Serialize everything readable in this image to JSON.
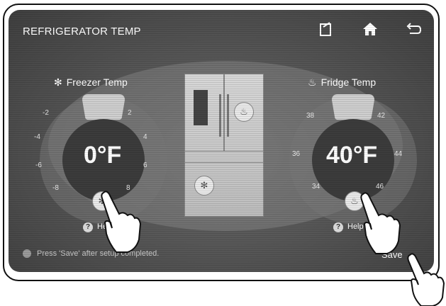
{
  "header": {
    "title": "REFRIGERATOR TEMP",
    "icons": [
      "memo-icon",
      "home-icon",
      "back-icon"
    ]
  },
  "freezer": {
    "label": "Freezer Temp",
    "value": "0°F",
    "ticks": [
      "-2",
      "2",
      "-4",
      "4",
      "-6",
      "6",
      "-8",
      "8"
    ],
    "button_icon": "snowflake-icon",
    "help_label": "Help"
  },
  "fridge": {
    "label": "Fridge Temp",
    "value": "40°F",
    "ticks": [
      "38",
      "42",
      "36",
      "44",
      "34",
      "46"
    ],
    "button_icon": "water-drop-icon",
    "help_label": "Help"
  },
  "status": {
    "text": "Press 'Save' after setup completed."
  },
  "save": {
    "label": "Save"
  }
}
